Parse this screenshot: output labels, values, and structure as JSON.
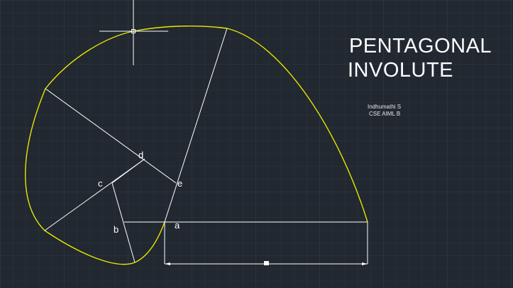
{
  "title": {
    "line1": "PENTAGONAL",
    "line2": "INVOLUTE"
  },
  "author": {
    "name": "Indhumathi S",
    "class": "CSE AIML B"
  },
  "points": {
    "a": "a",
    "b": "b",
    "c": "c",
    "d": "d",
    "e": "e"
  },
  "colors": {
    "background": "#212830",
    "grid": "#2e3744",
    "curve": "#e6e600",
    "lines": "#ffffff"
  }
}
